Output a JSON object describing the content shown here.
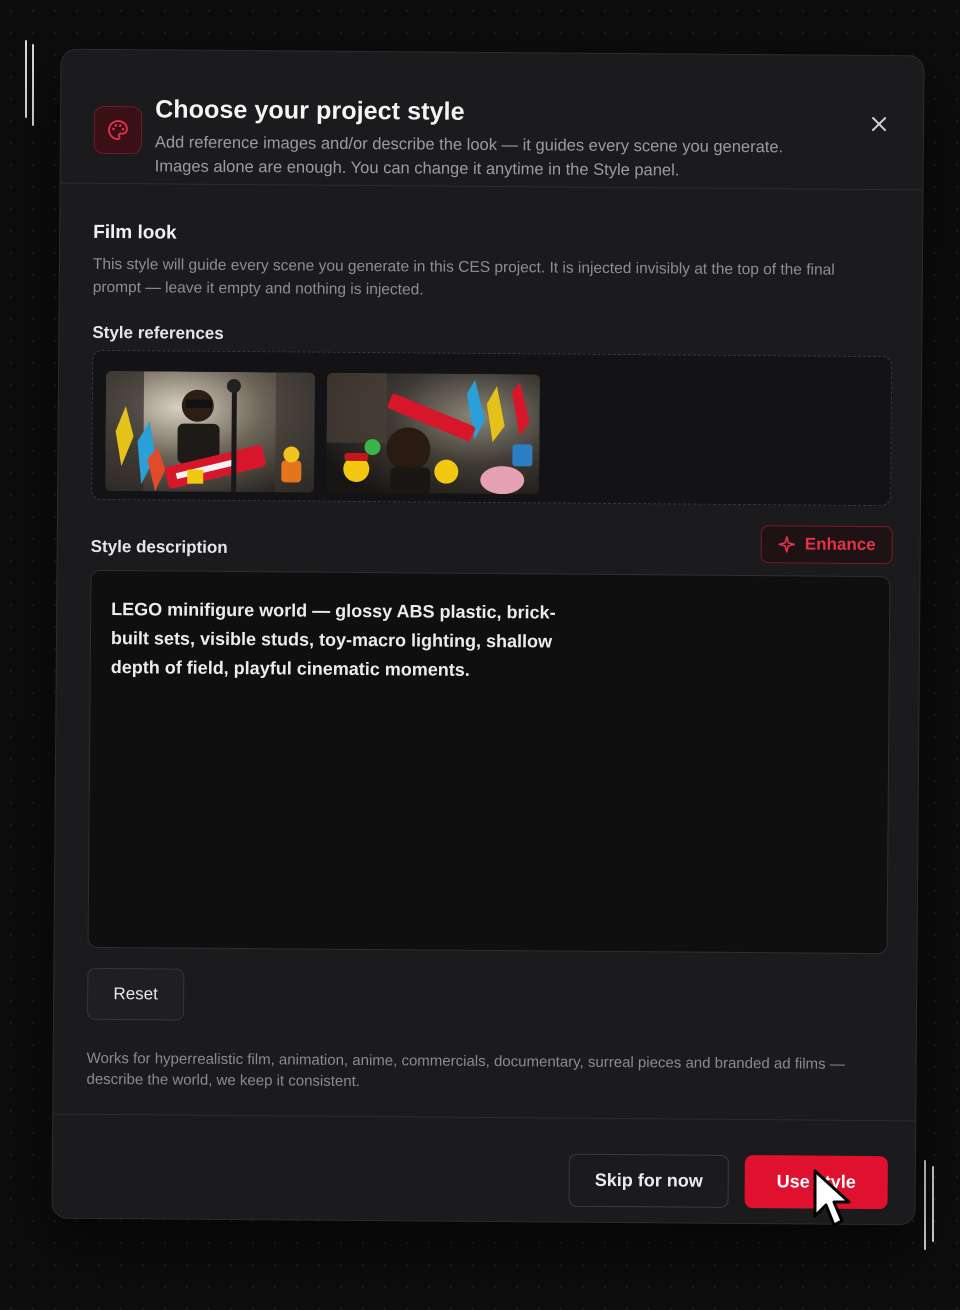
{
  "modal": {
    "title": "Choose your project style",
    "subtitle": "Add reference images and/or describe the look — it guides every scene you generate. Images alone are enough. You can change it anytime in the Style panel.",
    "header_icon": "palette-icon",
    "close_icon": "close-icon"
  },
  "film_look": {
    "title": "Film look",
    "description": "This style will guide every scene you generate in this CES project. It is injected invisibly at the top of the final prompt — leave it empty and nothing is injected."
  },
  "style_references": {
    "label": "Style references",
    "images": [
      {
        "name": "lego-keytar-musician"
      },
      {
        "name": "lego-crowd-concert"
      }
    ]
  },
  "style_description": {
    "label": "Style description",
    "enhance_label": "Enhance",
    "enhance_icon": "sparkle-icon",
    "value": "LEGO minifigure world — glossy ABS plastic, brick-built sets, visible studs, toy-macro lighting, shallow depth of field, playful cinematic moments."
  },
  "reset_label": "Reset",
  "footnote": "Works for hyperrealistic film, animation, anime, commercials, documentary, surreal pieces and branded ad films — describe the world, we keep it consistent.",
  "footer": {
    "skip_label": "Skip for now",
    "use_label": "Use style"
  },
  "colors": {
    "accent": "#e0102f",
    "background": "#0d0d0e",
    "panel": "#1b1b1d"
  }
}
